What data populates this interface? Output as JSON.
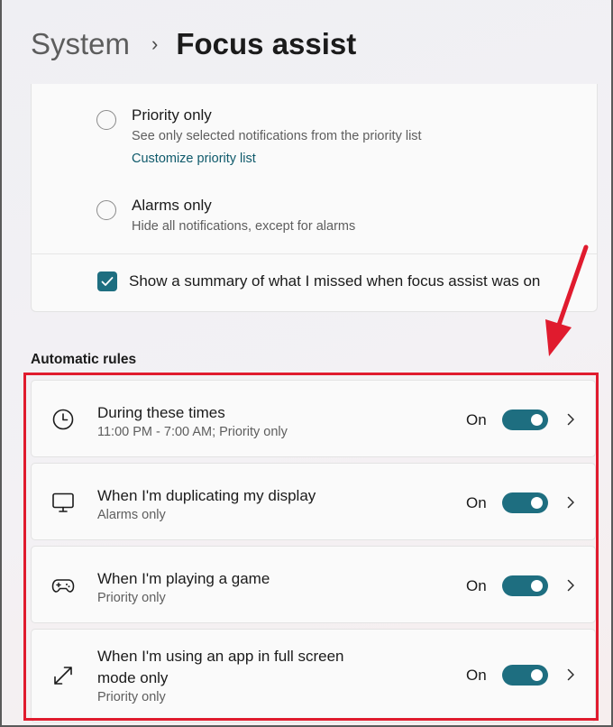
{
  "breadcrumb": {
    "parent": "System",
    "separator": "›",
    "current": "Focus assist"
  },
  "focus_options": [
    {
      "label": "Priority only",
      "description": "See only selected notifications from the priority list",
      "link": "Customize priority list",
      "selected": false
    },
    {
      "label": "Alarms only",
      "description": "Hide all notifications, except for alarms",
      "selected": false
    }
  ],
  "summary_checkbox": {
    "label": "Show a summary of what I missed when focus assist was on",
    "checked": true
  },
  "automatic_rules": {
    "title": "Automatic rules",
    "rules": [
      {
        "icon": "clock-icon",
        "title": "During these times",
        "subtitle": "11:00 PM - 7:00 AM; Priority only",
        "state": "On",
        "enabled": true
      },
      {
        "icon": "monitor-icon",
        "title": "When I'm duplicating my display",
        "subtitle": "Alarms only",
        "state": "On",
        "enabled": true
      },
      {
        "icon": "gamepad-icon",
        "title": "When I'm playing a game",
        "subtitle": "Priority only",
        "state": "On",
        "enabled": true
      },
      {
        "icon": "fullscreen-icon",
        "title_line1": "When I'm using an app in full screen",
        "title_line2": "mode only",
        "subtitle": "Priority only",
        "state": "On",
        "enabled": true
      }
    ]
  },
  "colors": {
    "accent": "#1e6e80",
    "link": "#0f5a6b",
    "annotation": "#e01b2e"
  }
}
